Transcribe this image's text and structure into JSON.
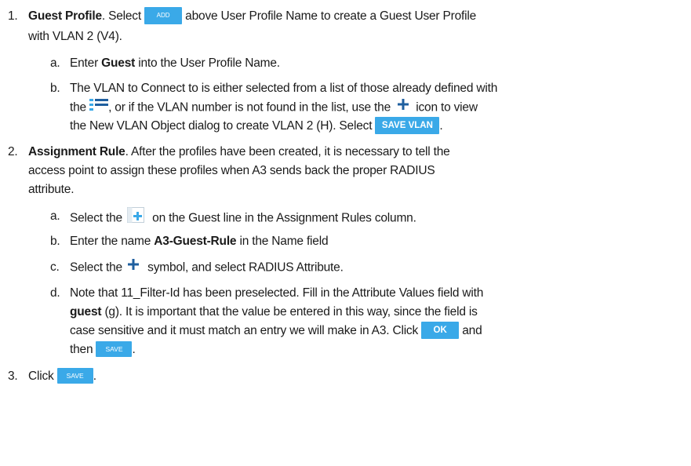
{
  "steps": [
    {
      "number": "1.",
      "title": "Guest Profile",
      "line1_a": ". Select ",
      "add_button": "ADD",
      "line1_b": " above User Profile Name to create a Guest User Profile",
      "line2": "with VLAN 2 (V4).",
      "substeps": [
        {
          "letter": "a.",
          "pre": "Enter ",
          "bold": "Guest",
          "post": " into the User Profile Name."
        },
        {
          "letter": "b.",
          "line1": "The VLAN to Connect to is either selected from a list of those already defined with",
          "line2_a": "the ",
          "line2_b": ", or if the VLAN number is not found in the list, use the ",
          "line2_c": " icon to view",
          "line3_a": "the New VLAN Object dialog to create VLAN 2 (H). Select ",
          "save_vlan_button": "SAVE VLAN",
          "line3_b": "."
        }
      ]
    },
    {
      "number": "2.",
      "title": "Assignment Rule",
      "line1": ". After the profiles have been created, it is necessary to tell the",
      "line2": "access point to assign these profiles when A3 sends back the proper RADIUS",
      "line3": "attribute.",
      "substeps": [
        {
          "letter": "a.",
          "pre": "Select the ",
          "post": " on the Guest line in the Assignment Rules column."
        },
        {
          "letter": "b.",
          "pre": "Enter the name ",
          "bold": "A3-Guest-Rule",
          "post": " in the Name field"
        },
        {
          "letter": "c.",
          "pre": "Select the ",
          "post": " symbol, and select RADIUS Attribute."
        },
        {
          "letter": "d.",
          "line1": "Note that 11_Filter-Id has been preselected. Fill in the Attribute Values field with",
          "line2_bold": "guest",
          "line2": " (g). It is important that the value be entered in this way, since the field is",
          "line3_a": "case sensitive and it must match an entry we will make in A3. Click ",
          "ok_button": "OK",
          "line3_b": " and",
          "line4_a": "then ",
          "save_button": "SAVE",
          "line4_b": "."
        }
      ]
    },
    {
      "number": "3.",
      "pre": "Click ",
      "save_button": "SAVE",
      "post": "."
    }
  ],
  "colors": {
    "button_bg": "#3aa9e8",
    "icon_blue": "#3aa9e8",
    "plus_blue": "#1f5f9f",
    "text": "#1a1a1a"
  },
  "icons": {
    "list": "list-icon",
    "plus": "plus-icon",
    "add_rule": "add-rule-icon"
  }
}
